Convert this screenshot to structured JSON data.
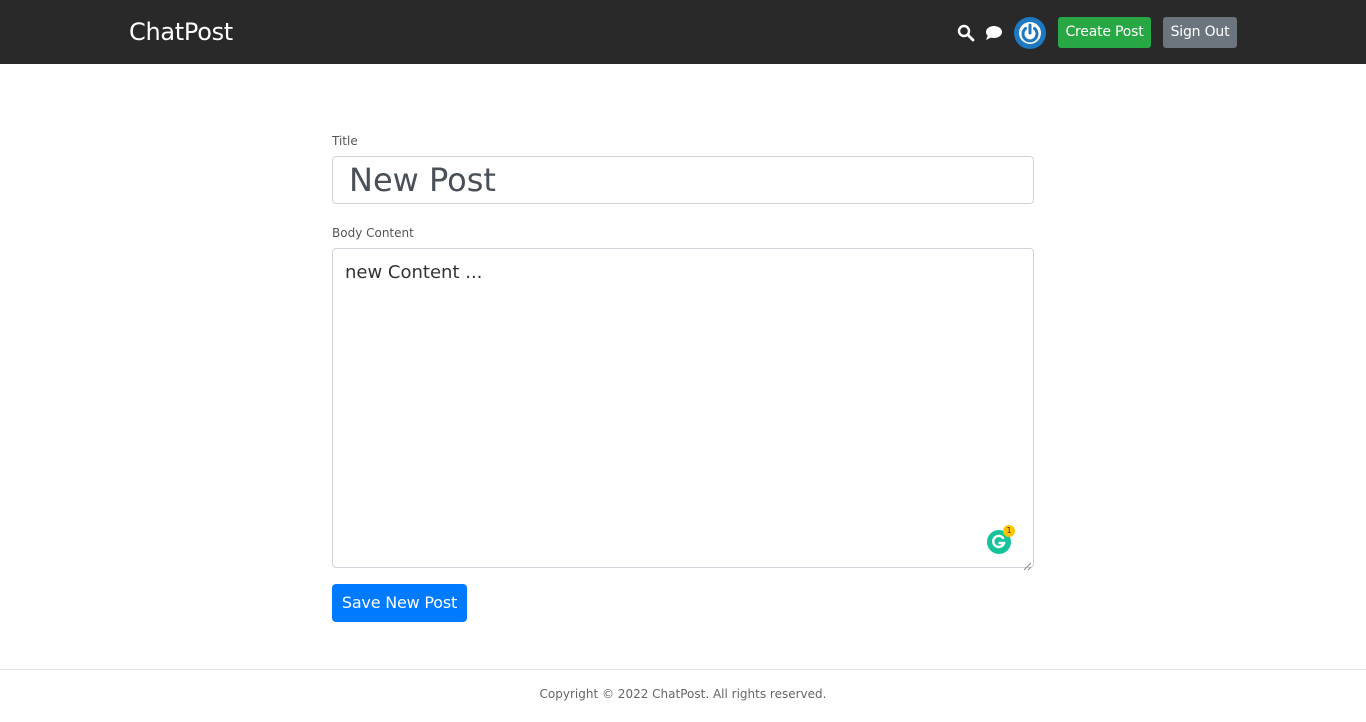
{
  "app": {
    "brand": "ChatPost"
  },
  "header": {
    "create_label": "Create Post",
    "signout_label": "Sign Out",
    "icons": [
      "search-icon",
      "chat-icon",
      "power-icon"
    ]
  },
  "form": {
    "title_label": "Title",
    "title_value": "New Post",
    "body_label": "Body Content",
    "body_value": "new Content ...",
    "grammarly_count": "1",
    "save_label": "Save New Post"
  },
  "footer": {
    "text": "Copyright © 2022 ChatPost. All rights reserved."
  },
  "colors": {
    "navbar": "#292929",
    "create_button": "#28a745",
    "signout_button": "#6c757d",
    "save_button": "#007bff",
    "avatar": "#1e78c2"
  }
}
